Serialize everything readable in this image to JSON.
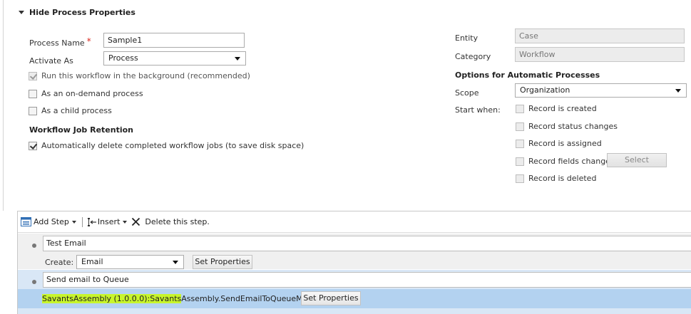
{
  "section": {
    "title": "Hide Process Properties"
  },
  "form": {
    "process_name_label": "Process Name",
    "required_marker": "*",
    "process_name_value": "Sample1",
    "activate_as_label": "Activate As",
    "activate_as_value": "Process",
    "background_label": "Run this workflow in the background (recommended)",
    "on_demand_label": "As an on-demand process",
    "child_label": "As a child process",
    "retention_title": "Workflow Job Retention",
    "auto_delete_label": "Automatically delete completed workflow jobs (to save disk space)"
  },
  "right": {
    "entity_label": "Entity",
    "entity_value": "Case",
    "category_label": "Category",
    "category_value": "Workflow",
    "options_title": "Options for Automatic Processes",
    "scope_label": "Scope",
    "scope_value": "Organization",
    "start_when_label": "Start when:",
    "record_created": "Record is created",
    "record_status": "Record status changes",
    "record_assigned": "Record is assigned",
    "record_fields": "Record fields change",
    "select_button": "Select",
    "record_deleted": "Record is deleted"
  },
  "toolbar": {
    "add_step": "Add Step",
    "insert": "Insert",
    "delete_step": "Delete this step."
  },
  "steps": {
    "step1_name": "Test Email",
    "create_label": "Create:",
    "create_value": "Email",
    "set_properties": "Set Properties",
    "step2_name": "Send email to Queue",
    "assembly_highlight": "SavantsAssembly (1.0.0.0):Savants",
    "assembly_rest": "Assembly.SendEmailToQueueMember",
    "set_properties_2": "Set Properties"
  },
  "states": {
    "background_checked": true,
    "auto_delete_checked": true
  }
}
